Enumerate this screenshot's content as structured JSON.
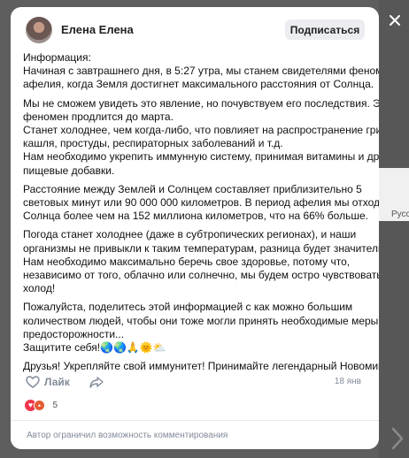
{
  "background": {
    "side_text": "Русс"
  },
  "post": {
    "author": "Елена Елена",
    "subscribe_label": "Подписаться",
    "paragraphs": [
      [
        "Информация:",
        "Начиная с завтрашнего дня, в 5:27 утра, мы станем свидетелями феномена",
        "афелия, когда Земля достигнет максимального расстояния от Солнца."
      ],
      [
        "Мы не сможем увидеть это явление, но почувствуем его последствия. Этот",
        "феномен продлится до марта.",
        "Станет холоднее, чем когда-либо, что повлияет на распространение гриппа,",
        "кашля, простуды, респираторных заболеваний и т.д.",
        "Нам необходимо укрепить иммунную систему, принимая витамины и другие",
        "пищевые добавки."
      ],
      [
        "Расстояние между Землей и Солнцем составляет приблизительно 5",
        "световых минут или 90 000 000 километров. В период афелия мы отходим от",
        "Солнца более чем на 152 миллиона километров, что на 66% больше."
      ],
      [
        "Погода станет холоднее (даже в субтропических регионах), и наши",
        "организмы не привыкли к таким температурам, разница будет значительной.",
        "Нам необходимо максимально беречь свое здоровье, потому что,",
        "независимо от того, облачно или солнечно, мы будем остро чувствовать",
        "холод!"
      ],
      [
        "Пожалуйста, поделитесь этой информацией с как можно большим",
        "количеством людей, чтобы они тоже могли принять необходимые меры",
        "предосторожности...",
        "Защитите себя!🌏🌏🙏🌞⛅"
      ],
      [
        "Друзья! Укрепляйте свой иммунитет! Принимайте легендарный Новомин!"
      ]
    ],
    "like_label": "Лайк",
    "date": "18 янв",
    "reactions_count": "5",
    "footer_text": "Автор ограничил возможность комментирования"
  }
}
